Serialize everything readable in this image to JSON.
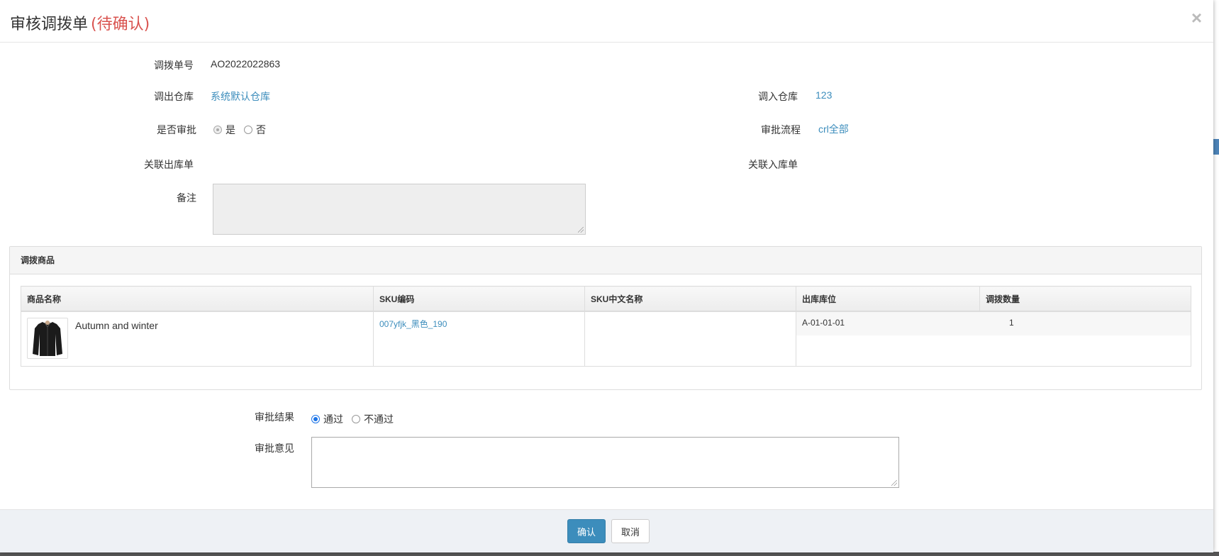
{
  "header": {
    "title": "审核调拨单",
    "status": "(待确认)",
    "close_icon": "×"
  },
  "form": {
    "order_no_label": "调拨单号",
    "order_no": "AO2022022863",
    "out_warehouse_label": "调出仓库",
    "out_warehouse": "系统默认仓库",
    "in_warehouse_label": "调入仓库",
    "in_warehouse": "123",
    "need_approval_label": "是否审批",
    "approval_yes": "是",
    "approval_no": "否",
    "approval_flow_label": "审批流程",
    "approval_flow": "crl全部",
    "related_out_label": "关联出库单",
    "related_in_label": "关联入库单",
    "remark_label": "备注"
  },
  "panel": {
    "title": "调拨商品",
    "columns": [
      "商品名称",
      "SKU编码",
      "SKU中文名称",
      "出库库位",
      "调拨数量"
    ],
    "rows": [
      {
        "name": "Autumn and winter",
        "sku": "007yfjk_黑色_190",
        "sku_cn": "",
        "location": "A-01-01-01",
        "qty": "1"
      }
    ]
  },
  "approval": {
    "result_label": "审批结果",
    "pass": "通过",
    "reject": "不通过",
    "opinion_label": "审批意见"
  },
  "footer": {
    "confirm": "确认",
    "cancel": "取消"
  },
  "colors": {
    "primary": "#3c8dbc",
    "status": "#d9534f"
  }
}
